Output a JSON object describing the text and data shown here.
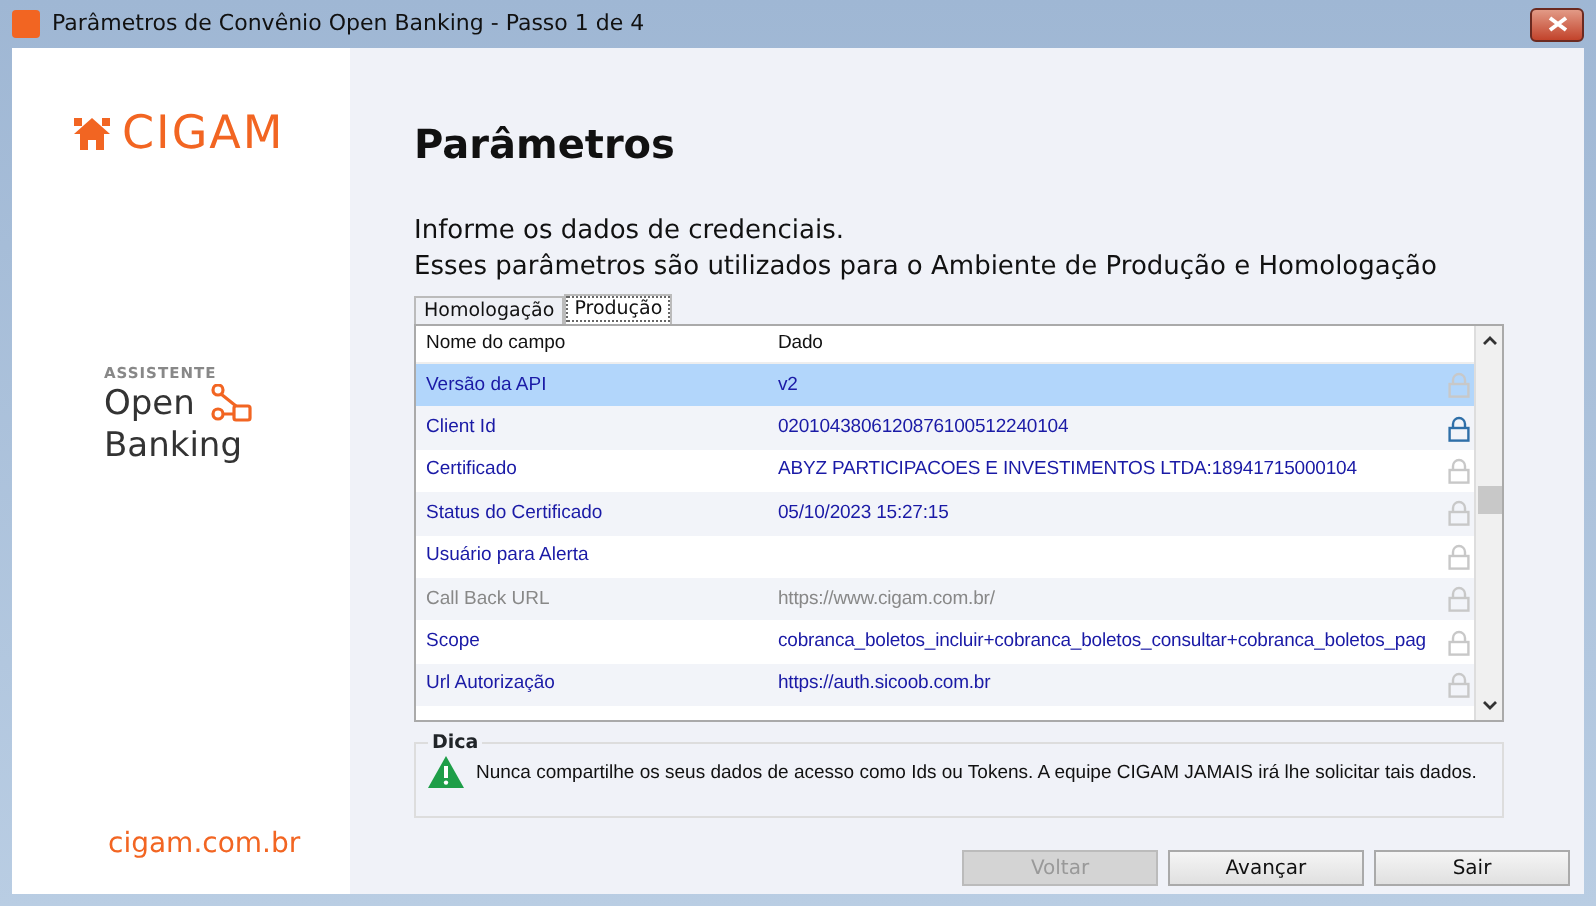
{
  "window": {
    "title": "Parâmetros de Convênio Open Banking - Passo 1 de 4"
  },
  "sidebar": {
    "logo_text": "CIGAM",
    "caption": "ASSISTENTE",
    "product_lines": [
      "Open",
      "Banking"
    ],
    "website": "cigam.com.br"
  },
  "heading": "Parâmetros",
  "intro": [
    "Informe os dados de credenciais.",
    "Esses parâmetros são utilizados para o Ambiente de Produção e Homologação"
  ],
  "tabs": [
    {
      "label": "Homologação",
      "selected": false
    },
    {
      "label": "Produção",
      "selected": true
    }
  ],
  "table": {
    "columns": [
      "Nome do campo",
      "Dado"
    ],
    "rows": [
      {
        "name": "Versão da API",
        "value": "v2",
        "selected": true,
        "disabled": false,
        "lock_active": false
      },
      {
        "name": "Client Id",
        "value": "0201043806120876100512240104",
        "selected": false,
        "disabled": false,
        "lock_active": true
      },
      {
        "name": "Certificado",
        "value": " ABYZ PARTICIPACOES E INVESTIMENTOS LTDA:18941715000104",
        "selected": false,
        "disabled": false,
        "lock_active": false
      },
      {
        "name": "Status do Certificado",
        "value": "05/10/2023 15:27:15",
        "selected": false,
        "disabled": false,
        "lock_active": false
      },
      {
        "name": "Usuário para Alerta",
        "value": "",
        "selected": false,
        "disabled": false,
        "lock_active": false
      },
      {
        "name": "Call Back URL",
        "value": "https://www.cigam.com.br/",
        "selected": false,
        "disabled": true,
        "lock_active": false
      },
      {
        "name": "Scope",
        "value": "cobranca_boletos_incluir+cobranca_boletos_consultar+cobranca_boletos_pag",
        "selected": false,
        "disabled": false,
        "lock_active": false
      },
      {
        "name": "Url Autorização",
        "value": "https://auth.sicoob.com.br",
        "selected": false,
        "disabled": false,
        "lock_active": false
      }
    ]
  },
  "tip": {
    "title": "Dica",
    "text": "Nunca compartilhe os seus dados de acesso como Ids ou Tokens. A equipe CIGAM JAMAIS irá lhe solicitar tais dados."
  },
  "buttons": [
    {
      "label": "Voltar",
      "disabled": true
    },
    {
      "label": "Avançar",
      "disabled": false
    },
    {
      "label": "Sair",
      "disabled": false
    }
  ]
}
